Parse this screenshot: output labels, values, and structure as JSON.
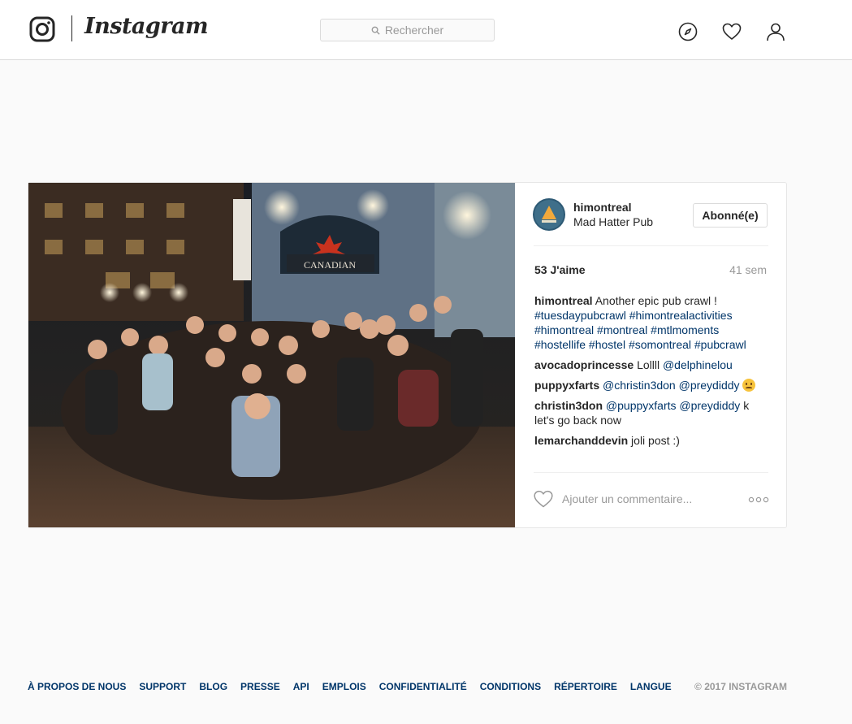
{
  "header": {
    "brand": "Instagram",
    "search_placeholder": "Rechercher"
  },
  "post": {
    "username": "himontreal",
    "location": "Mad Hatter Pub",
    "follow_label": "Abonné(e)",
    "likes": "53 J'aime",
    "time_ago": "41 sem",
    "storefront_sign": "CANADIAN",
    "caption": {
      "author": "himontreal",
      "text": "Another epic pub crawl !",
      "hashtags": "#tuesdaypubcrawl #himontrealactivities #himontreal #montreal #mtlmoments #hostellife #hostel #somontreal #pubcrawl"
    },
    "comments": [
      {
        "author": "avocadoprincesse",
        "text": "Lollll",
        "mention": "@delphinelou"
      },
      {
        "author": "puppyxfarts",
        "mention": "@christin3don @preydiddy",
        "emoji": "disappointed-face"
      },
      {
        "author": "christin3don",
        "mention": "@puppyxfarts @preydiddy",
        "text": "k let's go back now"
      },
      {
        "author": "lemarchanddevin",
        "text": "joli post :)"
      }
    ],
    "add_comment_placeholder": "Ajouter un commentaire..."
  },
  "footer": {
    "links": [
      "À PROPOS DE NOUS",
      "SUPPORT",
      "BLOG",
      "PRESSE",
      "API",
      "EMPLOIS",
      "CONFIDENTIALITÉ",
      "CONDITIONS",
      "RÉPERTOIRE",
      "LANGUE"
    ],
    "copyright": "© 2017 INSTAGRAM"
  },
  "colors": {
    "link": "#003569",
    "muted": "#999999",
    "text": "#262626",
    "border": "#dbdbdb"
  }
}
